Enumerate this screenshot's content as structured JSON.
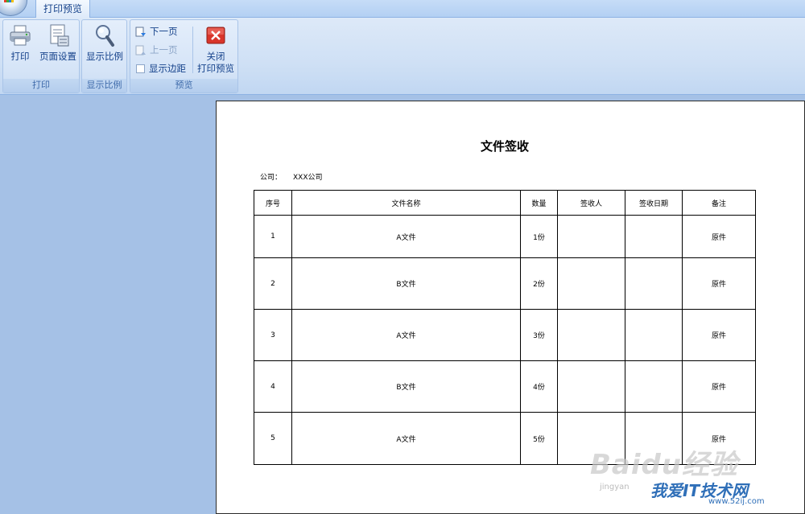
{
  "ribbon": {
    "active_tab": "打印预览",
    "groups": {
      "print": {
        "label": "打印",
        "print_button": "打印",
        "page_setup_button": "页面设置"
      },
      "zoom": {
        "label": "显示比例",
        "zoom_button": "显示比例"
      },
      "preview": {
        "label": "预览",
        "next_page": "下一页",
        "prev_page": "上一页",
        "show_margins": "显示边距",
        "close_line1": "关闭",
        "close_line2": "打印预览"
      }
    }
  },
  "document": {
    "title": "文件签收",
    "company_label": "公司：",
    "company_value": "XXX公司",
    "headers": [
      "序号",
      "文件名称",
      "数量",
      "签收人",
      "签收日期",
      "备注"
    ],
    "rows": [
      [
        "1",
        "A文件",
        "1份",
        "",
        "",
        "原件"
      ],
      [
        "2",
        "B文件",
        "2份",
        "",
        "",
        "原件"
      ],
      [
        "3",
        "A文件",
        "3份",
        "",
        "",
        "原件"
      ],
      [
        "4",
        "B文件",
        "4份",
        "",
        "",
        "原件"
      ],
      [
        "5",
        "A文件",
        "5份",
        "",
        "",
        "原件"
      ]
    ]
  },
  "watermark": {
    "baidu": "Baidu经验",
    "baidu_url": "jingyan",
    "site": "我爱IT技术网",
    "site_url": "www.52ij.com"
  },
  "colors": {
    "workspace_bg": "#a5c1e6",
    "ribbon_text": "#15428b",
    "close_icon_red": "#d9352b"
  }
}
